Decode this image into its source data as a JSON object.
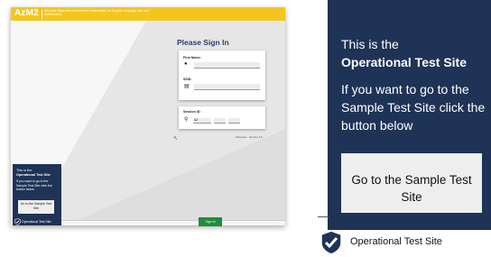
{
  "thumbnail": {
    "logo": "AzM2",
    "tagline": "Arizona's Statewide Achievement Assessment for English Language Arts and Mathematics",
    "signin_title": "Please Sign In",
    "first_name_label": "First Name:",
    "ssid_label": "SSID:",
    "session_label": "Session ID:",
    "session_prefix": "AZ",
    "version": "Windows - Version 4.0",
    "signin_button": "Sign In",
    "panel": {
      "line1": "This is the",
      "line2": "Operational Test Site",
      "message": "If you want to go to the Sample Test Site click the button below",
      "button": "Go to the Sample Test Site",
      "footer": "Operational Test Site"
    }
  },
  "zoom_panel": {
    "line1": "This is the",
    "line2": "Operational Test Site",
    "message": "If you want to go to the Sample Test Site click the button below",
    "button": "Go to the Sample Test Site",
    "footer": "Operational Test Site"
  },
  "colors": {
    "brand_yellow": "#f4c51d",
    "panel_navy": "#1e3356",
    "signin_green": "#1f8d3b"
  }
}
